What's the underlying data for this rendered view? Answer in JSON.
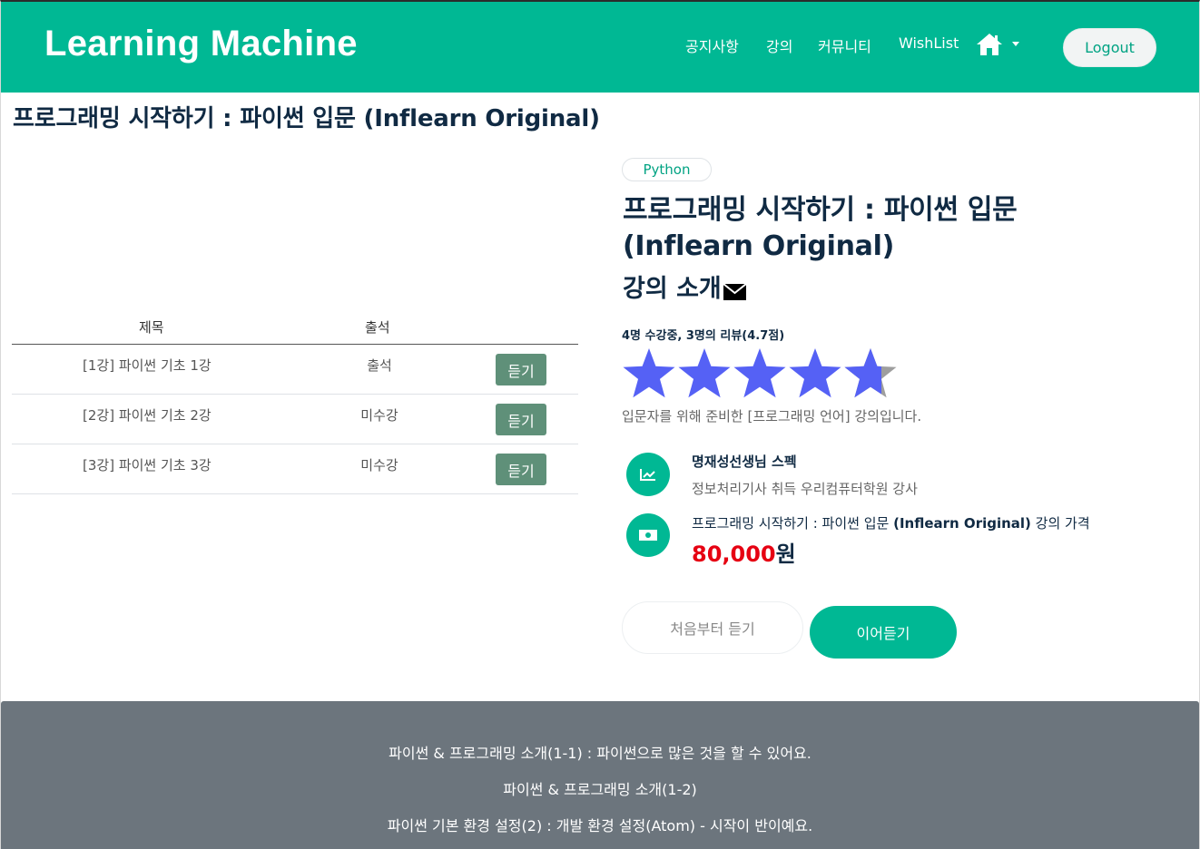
{
  "navbar": {
    "brand": "Learning Machine",
    "links": [
      "공지사항",
      "강의",
      "커뮤니티",
      "WishList"
    ],
    "logout_label": "Logout",
    "accent": "#00b894"
  },
  "page": {
    "title": "프로그래밍 시작하기 : 파이썬 입문 (Inflearn Original)"
  },
  "table": {
    "headers": [
      "제목",
      "출석"
    ],
    "rows": [
      {
        "title": "[1강] 파이썬 기초 1강",
        "attendance": "출석",
        "button": "듣기"
      },
      {
        "title": "[2강] 파이썬 기초 2강",
        "attendance": "미수강",
        "button": "듣기"
      },
      {
        "title": "[3강] 파이썬 기초 3강",
        "attendance": "미수강",
        "button": "듣기"
      }
    ]
  },
  "course": {
    "tag": "Python",
    "title": "프로그래밍 시작하기 : 파이썬 입문 (Inflearn Original)",
    "intro": "강의 소개",
    "stats": "4명 수강중, 3명의 리뷰(4.7점)",
    "rating": 4.7,
    "rating_max": 5,
    "description": "입문자를 위해 준비한 [프로그래밍 언어] 강의입니다.",
    "spec_title": "명재성선생님 스펙",
    "spec_detail": "정보처리기사 취득 우리컴퓨터학원 강사",
    "price_label_prefix": "프로그래밍 시작하기 : 파이썬 입문 ",
    "price_label_bold": "(Inflearn Original)",
    "price_label_suffix": " 강의 가격",
    "price_value": "80,000",
    "price_unit": "원",
    "btn_start": "처음부터 듣기",
    "btn_continue": "이어듣기"
  },
  "lectures": [
    "파이썬 & 프로그래밍 소개(1-1) : 파이썬으로 많은 것을 할 수 있어요.",
    "파이썬 & 프로그래밍 소개(1-2)",
    "파이썬 기본 환경 설정(2) : 개발 환경 설정(Atom) - 시작이 반이예요."
  ],
  "icons": {
    "home": "home-icon",
    "mail": "envelope-icon",
    "spec": "chart-line-icon",
    "price": "money-bill-icon",
    "star": "star-icon"
  }
}
